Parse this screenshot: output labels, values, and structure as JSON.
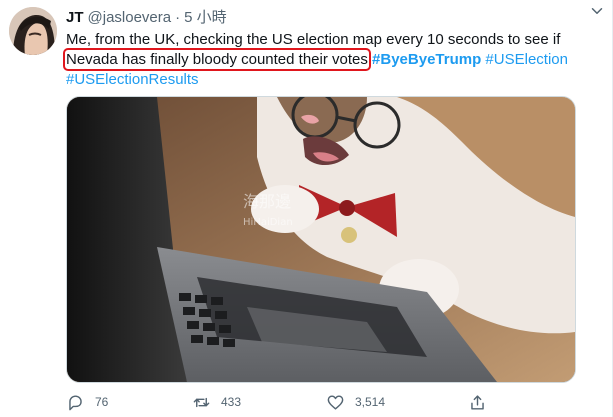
{
  "tweet": {
    "display_name": "JT",
    "handle": "@jasloevera",
    "separator": "·",
    "time": "5 小時",
    "text": {
      "line1": "Me, from the UK, checking the US election map every 10 seconds to see if",
      "highlighted": "Nevada has finally bloody counted their votes",
      "hashtag1": "#ByeByeTrump",
      "hashtag2": "#USElection",
      "hashtag3": "#USElectionResults"
    },
    "highlight_color": "#e0161d",
    "link_color": "#1d9bf0",
    "media": {
      "watermark_cn": "海那邊",
      "watermark_en": "HiHaiDian"
    }
  },
  "actions": {
    "reply": {
      "icon": "reply-icon",
      "count": "76"
    },
    "retweet": {
      "icon": "retweet-icon",
      "count": "433"
    },
    "like": {
      "icon": "heart-icon",
      "count": "3,514"
    },
    "share": {
      "icon": "share-icon"
    }
  },
  "icons": {
    "more": "chevron-down-icon"
  }
}
